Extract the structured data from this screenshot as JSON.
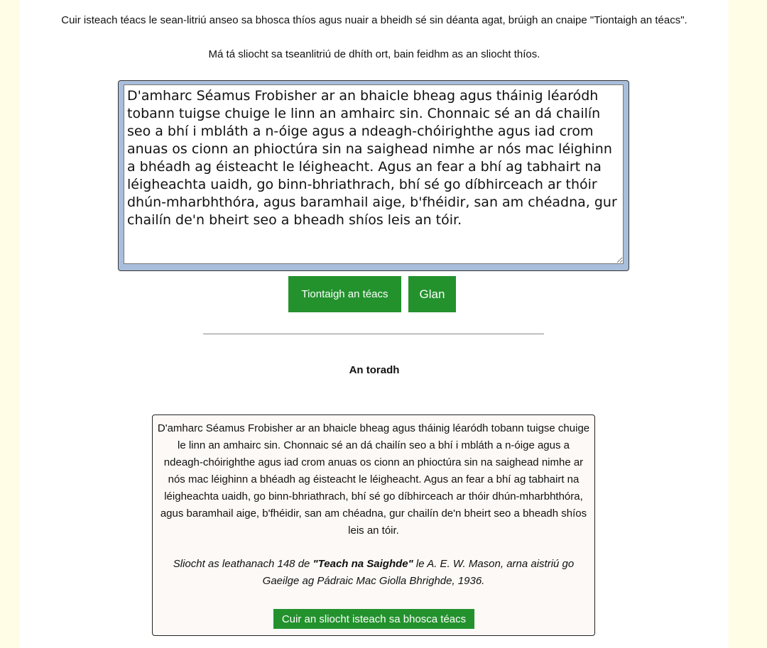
{
  "intro": {
    "line1": "Cuir isteach téacs le sean-litriú anseo sa bhosca thíos agus nuair a bheidh sé sin déanta agat, brúigh an cnaipe \"Tiontaigh an téacs\".",
    "line2": "Má tá sliocht sa tseanlitriú de dhíth ort, bain feidhm as an sliocht thíos."
  },
  "input": {
    "value": "D'amharc Séamus Frobisher ar an bhaicle bheag agus tháinig léaródh tobann tuigse chuige le linn an amhairc sin. Chonnaic sé an dá chailín seo a bhí i mbláth a n-óige agus a ndeagh-chóirighthe agus iad crom anuas os cionn an phioctúra sin na saighead nimhe ar nós mac léighinn a bhéadh ag éisteacht le léigheacht. Agus an fear a bhí ag tabhairt na léigheachta uaidh, go binn-bhriathrach, bhí sé go díbhirceach ar thóir dhún-mharbhthóra, agus baramhail aige, b'fhéidir, san am chéadna, gur chailín de'n bheirt seo a bheadh shíos leis an tóir."
  },
  "buttons": {
    "convert": "Tiontaigh an téacs",
    "clear": "Glan",
    "insert": "Cuir an sliocht isteach sa bhosca téacs"
  },
  "result": {
    "heading": "An toradh",
    "text": "D'amharc Séamus Frobisher ar an bhaicle bheag agus tháinig léaródh tobann tuigse chuige le linn an amhairc sin. Chonnaic sé an dá chailín seo a bhí i mbláth a n-óige agus a ndeagh-chóirighthe agus iad crom anuas os cionn an phioctúra sin na saighead nimhe ar nós mac léighinn a bhéadh ag éisteacht le léigheacht. Agus an fear a bhí ag tabhairt na léigheachta uaidh, go binn-bhriathrach, bhí sé go díbhirceach ar thóir dhún-mharbhthóra, agus baramhail aige, b'fhéidir, san am chéadna, gur chailín de'n bheirt seo a bheadh shíos leis an tóir.",
    "citation_prefix": "Sliocht as leathanach 148 de ",
    "citation_title": "\"Teach na Saighde\"",
    "citation_suffix": " le A. E. W. Mason, arna aistriú go Gaeilge ag Pádraic Mac Giolla Bhrighde, 1936."
  },
  "colors": {
    "button_green": "#23922d",
    "page_margin": "#fffde6",
    "textarea_frame": "#a8bedc"
  }
}
